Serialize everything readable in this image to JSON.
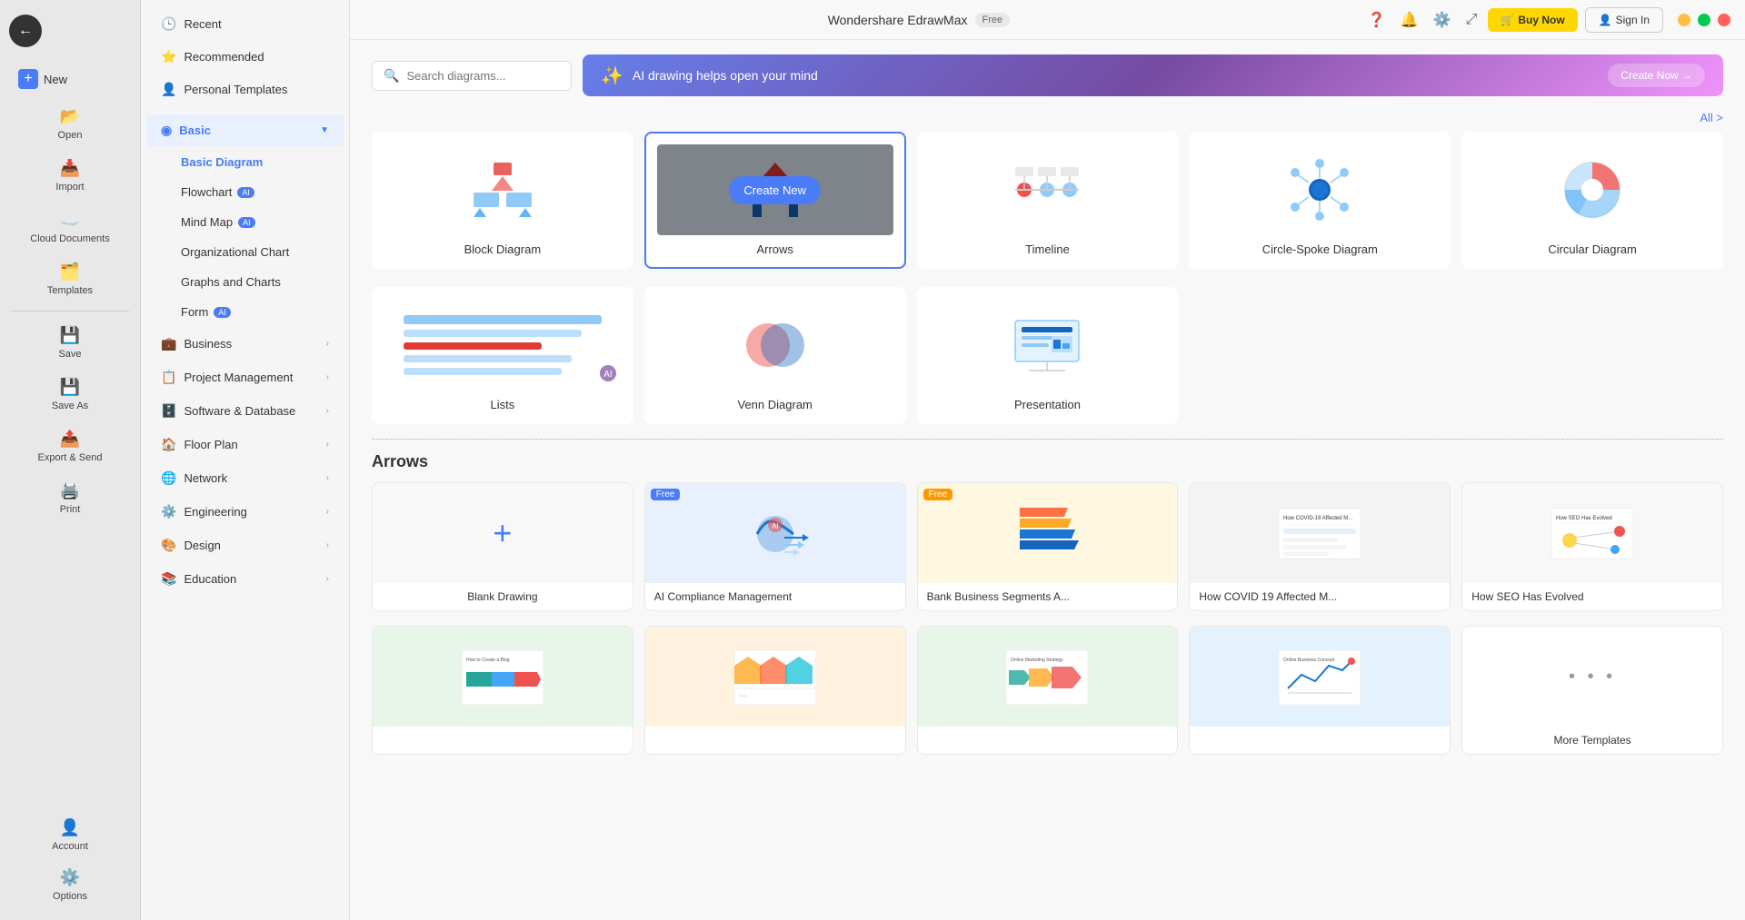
{
  "app": {
    "name": "Wondershare EdrawMax",
    "free_badge": "Free",
    "buy_now": "Buy Now",
    "sign_in": "Sign In"
  },
  "search": {
    "placeholder": "Search diagrams..."
  },
  "banner": {
    "text": "AI drawing helps open your mind",
    "cta": "Create Now →"
  },
  "all_link": "All >",
  "sidebar_narrow": {
    "items": [
      {
        "id": "new",
        "label": "New",
        "icon": "+"
      },
      {
        "id": "open",
        "label": "Open",
        "icon": "📂"
      },
      {
        "id": "import",
        "label": "Import",
        "icon": "📥"
      },
      {
        "id": "cloud",
        "label": "Cloud Documents",
        "icon": "☁️"
      },
      {
        "id": "templates",
        "label": "Templates",
        "icon": "🗂️"
      },
      {
        "id": "save",
        "label": "Save",
        "icon": "💾"
      },
      {
        "id": "saveas",
        "label": "Save As",
        "icon": "💾"
      },
      {
        "id": "export",
        "label": "Export & Send",
        "icon": "📤"
      },
      {
        "id": "print",
        "label": "Print",
        "icon": "🖨️"
      }
    ],
    "bottom_items": [
      {
        "id": "account",
        "label": "Account",
        "icon": "👤"
      },
      {
        "id": "options",
        "label": "Options",
        "icon": "⚙️"
      }
    ]
  },
  "sidebar_wide": {
    "menu_items": [
      {
        "id": "recent",
        "label": "Recent",
        "icon": "🕒"
      },
      {
        "id": "recommended",
        "label": "Recommended",
        "icon": "⭐"
      },
      {
        "id": "personal",
        "label": "Personal Templates",
        "icon": "👤"
      }
    ],
    "sections": [
      {
        "id": "basic",
        "label": "Basic",
        "expanded": true,
        "sub_items": [
          {
            "id": "basic-diagram",
            "label": "Basic Diagram",
            "active": true
          },
          {
            "id": "flowchart",
            "label": "Flowchart",
            "badge": "AI",
            "badge_type": "blue"
          },
          {
            "id": "mind-map",
            "label": "Mind Map",
            "badge": "AI",
            "badge_type": "blue"
          },
          {
            "id": "org-chart",
            "label": "Organizational Chart"
          },
          {
            "id": "graphs",
            "label": "Graphs and Charts"
          },
          {
            "id": "form",
            "label": "Form",
            "badge": "AI",
            "badge_type": "blue"
          }
        ]
      },
      {
        "id": "business",
        "label": "Business",
        "has_arrow": true
      },
      {
        "id": "project",
        "label": "Project Management",
        "has_arrow": true
      },
      {
        "id": "software-db",
        "label": "Software & Database",
        "has_arrow": true
      },
      {
        "id": "floor-plan",
        "label": "Floor Plan",
        "has_arrow": true
      },
      {
        "id": "network",
        "label": "Network",
        "has_arrow": true
      },
      {
        "id": "engineering",
        "label": "Engineering",
        "has_arrow": true
      },
      {
        "id": "design",
        "label": "Design",
        "has_arrow": true
      },
      {
        "id": "education",
        "label": "Education",
        "has_arrow": true
      }
    ]
  },
  "template_cards": [
    {
      "id": "block-diagram",
      "label": "Block Diagram",
      "selected": false
    },
    {
      "id": "arrows",
      "label": "Arrows",
      "selected": true,
      "show_create_new": true
    },
    {
      "id": "timeline",
      "label": "Timeline",
      "selected": false
    },
    {
      "id": "circle-spoke",
      "label": "Circle-Spoke Diagram",
      "selected": false
    },
    {
      "id": "circular",
      "label": "Circular Diagram",
      "selected": false
    },
    {
      "id": "lists",
      "label": "Lists",
      "selected": false
    },
    {
      "id": "venn",
      "label": "Venn Diagram",
      "selected": false
    },
    {
      "id": "presentation",
      "label": "Presentation",
      "selected": false
    }
  ],
  "arrows_section": {
    "title": "Arrows",
    "templates": [
      {
        "id": "blank",
        "label": "Blank Drawing",
        "is_blank": true,
        "free": false
      },
      {
        "id": "ai-compliance",
        "label": "AI Compliance Management",
        "free": true,
        "free_color": "blue"
      },
      {
        "id": "bank-business",
        "label": "Bank Business Segments A...",
        "free": true,
        "free_color": "orange"
      },
      {
        "id": "covid19",
        "label": "How COVID 19 Affected M...",
        "free": false
      },
      {
        "id": "seo-evolved",
        "label": "How SEO Has Evolved",
        "free": false
      }
    ],
    "second_row": [
      {
        "id": "how-create-blog",
        "label": "",
        "free": false
      },
      {
        "id": "template2",
        "label": "",
        "free": false
      },
      {
        "id": "marketing",
        "label": "",
        "free": false
      },
      {
        "id": "concept",
        "label": "",
        "free": false
      },
      {
        "id": "more",
        "label": "More Templates",
        "is_more": true
      }
    ]
  },
  "create_new_label": "Create New"
}
